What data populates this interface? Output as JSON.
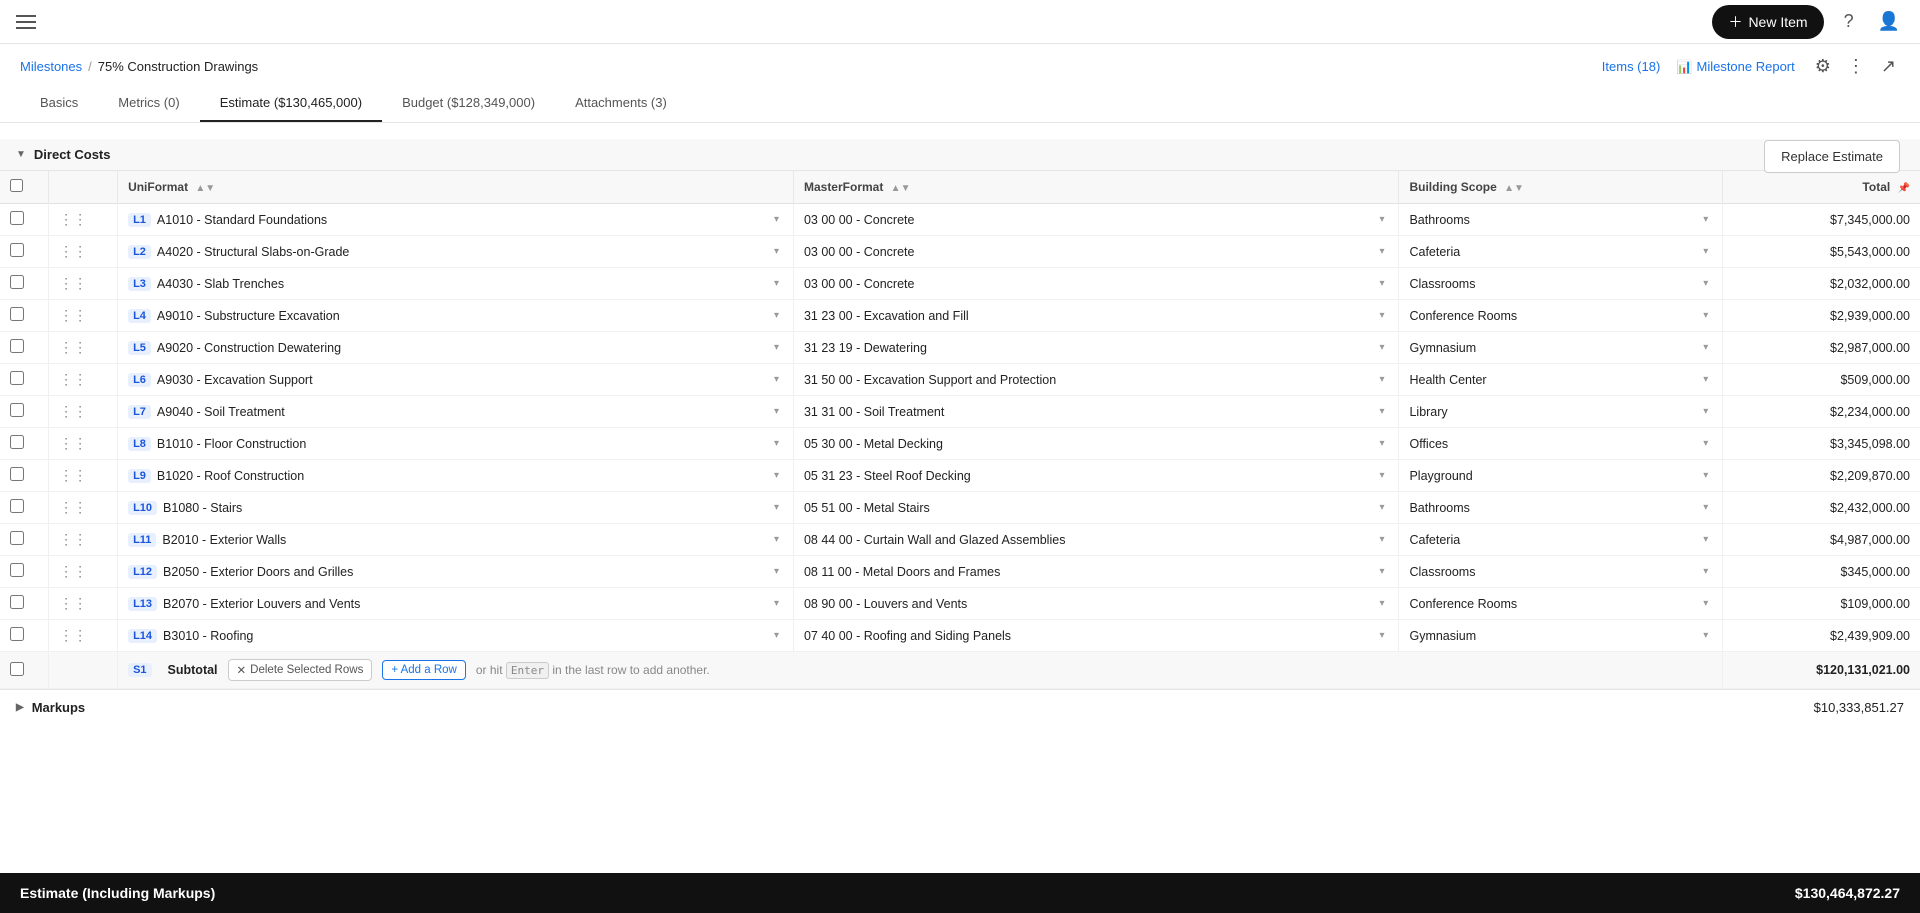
{
  "topbar": {
    "new_item_label": "New Item"
  },
  "breadcrumb": {
    "parent": "Milestones",
    "separator": "/",
    "current": "75% Construction Drawings"
  },
  "top_actions": {
    "items_label": "Items (18)",
    "milestone_report_label": "Milestone Report"
  },
  "tabs": [
    {
      "id": "basics",
      "label": "Basics"
    },
    {
      "id": "metrics",
      "label": "Metrics (0)"
    },
    {
      "id": "estimate",
      "label": "Estimate ($130,465,000)",
      "active": true
    },
    {
      "id": "budget",
      "label": "Budget ($128,349,000)"
    },
    {
      "id": "attachments",
      "label": "Attachments (3)"
    }
  ],
  "replace_estimate_label": "Replace Estimate",
  "direct_costs": {
    "section_label": "Direct Costs",
    "columns": {
      "uniformal": "UniFormat",
      "masterformat": "MasterFormat",
      "building_scope": "Building Scope",
      "total": "Total"
    },
    "rows": [
      {
        "label": "L1",
        "uniformal": "A1010 - Standard Foundations",
        "masterformat": "03 00 00 - Concrete",
        "building_scope": "Bathrooms",
        "total": "$7,345,000.00"
      },
      {
        "label": "L2",
        "uniformal": "A4020 - Structural Slabs-on-Grade",
        "masterformat": "03 00 00 - Concrete",
        "building_scope": "Cafeteria",
        "total": "$5,543,000.00"
      },
      {
        "label": "L3",
        "uniformal": "A4030 - Slab Trenches",
        "masterformat": "03 00 00 - Concrete",
        "building_scope": "Classrooms",
        "total": "$2,032,000.00"
      },
      {
        "label": "L4",
        "uniformal": "A9010 - Substructure Excavation",
        "masterformat": "31 23 00 - Excavation and Fill",
        "building_scope": "Conference Rooms",
        "total": "$2,939,000.00"
      },
      {
        "label": "L5",
        "uniformal": "A9020 - Construction Dewatering",
        "masterformat": "31 23 19 - Dewatering",
        "building_scope": "Gymnasium",
        "total": "$2,987,000.00"
      },
      {
        "label": "L6",
        "uniformal": "A9030 - Excavation Support",
        "masterformat": "31 50 00 - Excavation Support and Protection",
        "building_scope": "Health Center",
        "total": "$509,000.00"
      },
      {
        "label": "L7",
        "uniformal": "A9040 - Soil Treatment",
        "masterformat": "31 31 00 - Soil Treatment",
        "building_scope": "Library",
        "total": "$2,234,000.00"
      },
      {
        "label": "L8",
        "uniformal": "B1010 - Floor Construction",
        "masterformat": "05 30 00 - Metal Decking",
        "building_scope": "Offices",
        "total": "$3,345,098.00"
      },
      {
        "label": "L9",
        "uniformal": "B1020 - Roof Construction",
        "masterformat": "05 31 23 - Steel Roof Decking",
        "building_scope": "Playground",
        "total": "$2,209,870.00"
      },
      {
        "label": "L10",
        "uniformal": "B1080 - Stairs",
        "masterformat": "05 51 00 - Metal Stairs",
        "building_scope": "Bathrooms",
        "total": "$2,432,000.00"
      },
      {
        "label": "L11",
        "uniformal": "B2010 - Exterior Walls",
        "masterformat": "08 44 00 - Curtain Wall and Glazed Assemblies",
        "building_scope": "Cafeteria",
        "total": "$4,987,000.00"
      },
      {
        "label": "L12",
        "uniformal": "B2050 - Exterior Doors and Grilles",
        "masterformat": "08 11 00 - Metal Doors and Frames",
        "building_scope": "Classrooms",
        "total": "$345,000.00"
      },
      {
        "label": "L13",
        "uniformal": "B2070 - Exterior Louvers and Vents",
        "masterformat": "08 90 00 - Louvers and Vents",
        "building_scope": "Conference Rooms",
        "total": "$109,000.00"
      },
      {
        "label": "L14",
        "uniformal": "B3010 - Roofing",
        "masterformat": "07 40 00 - Roofing and Siding Panels",
        "building_scope": "Gymnasium",
        "total": "$2,439,909.00"
      }
    ],
    "subtotal": {
      "label": "S1",
      "text": "Subtotal",
      "total": "$120,131,021.00",
      "delete_label": "Delete Selected Rows",
      "add_row_label": "+ Add a Row",
      "hint": "or hit",
      "key": "Enter",
      "hint2": "in the last row to add another."
    }
  },
  "markups": {
    "label": "Markups",
    "total": "$10,333,851.27"
  },
  "footer": {
    "label": "Estimate (Including Markups)",
    "total": "$130,464,872.27"
  }
}
